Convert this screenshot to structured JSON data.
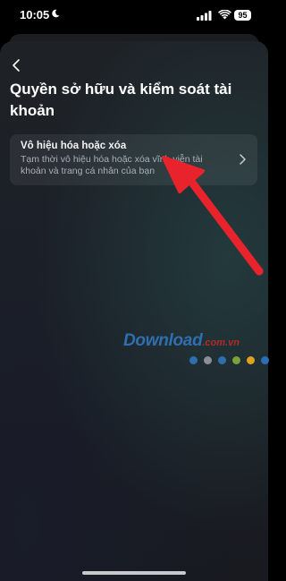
{
  "status_bar": {
    "time": "10:05",
    "moon_icon": "moon-icon",
    "battery": "95"
  },
  "header": {
    "back_icon": "chevron-left-icon",
    "title": "Quyền sở hữu và kiểm soát tài khoản"
  },
  "option": {
    "title": "Vô hiệu hóa hoặc xóa",
    "description": "Tạm thời vô hiệu hóa hoặc xóa vĩnh viễn tài khoản và trang cá nhân của bạn",
    "chevron_icon": "chevron-right-icon"
  },
  "annotation": {
    "arrow_color": "#e8232b"
  },
  "watermark": {
    "text": "Download",
    "suffix": ".com.vn",
    "dot_colors": [
      "#2f6fb0",
      "#8a8f96",
      "#2f6fb0",
      "#7aa23a",
      "#e0a020",
      "#2a6fb5",
      "#c8302d"
    ]
  },
  "colors": {
    "background": "#1c2127",
    "card": "#25292f",
    "text_primary": "#ffffff",
    "text_secondary": "#aab0b8"
  }
}
